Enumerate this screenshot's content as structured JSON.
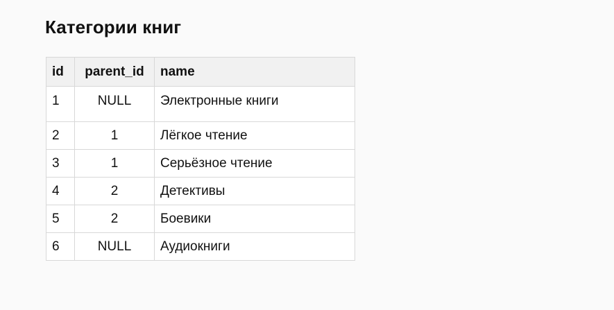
{
  "title": "Категории книг",
  "table": {
    "columns": [
      "id",
      "parent_id",
      "name"
    ],
    "rows": [
      {
        "id": "1",
        "parent_id": "NULL",
        "name": "Электронные книги"
      },
      {
        "id": "2",
        "parent_id": "1",
        "name": "Лёгкое чтение"
      },
      {
        "id": "3",
        "parent_id": "1",
        "name": "Серьёзное чтение"
      },
      {
        "id": "4",
        "parent_id": "2",
        "name": "Детективы"
      },
      {
        "id": "5",
        "parent_id": "2",
        "name": "Боевики"
      },
      {
        "id": "6",
        "parent_id": "NULL",
        "name": "Аудиокниги"
      }
    ]
  }
}
